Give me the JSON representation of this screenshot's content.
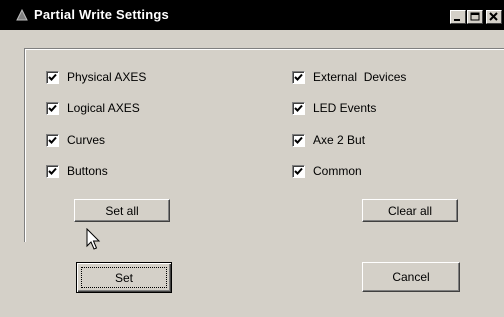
{
  "window": {
    "title": "Partial Write Settings",
    "controls": {
      "minimize": "minimize-icon",
      "maximize": "maximize-icon",
      "close": "close-icon"
    }
  },
  "settings": {
    "left": [
      {
        "label": "Physical AXES",
        "checked": true
      },
      {
        "label": "Logical AXES",
        "checked": true
      },
      {
        "label": "Curves",
        "checked": true
      },
      {
        "label": "Buttons",
        "checked": true
      }
    ],
    "right": [
      {
        "label": "External  Devices",
        "checked": true
      },
      {
        "label": "LED Events",
        "checked": true
      },
      {
        "label": "Axe 2 But",
        "checked": true
      },
      {
        "label": "Common",
        "checked": true
      }
    ],
    "set_all_label": "Set all",
    "clear_all_label": "Clear all"
  },
  "footer": {
    "set_label": "Set",
    "cancel_label": "Cancel"
  },
  "colors": {
    "face": "#d4d0c8",
    "titlebar": "#000000",
    "title_text": "#ffffff"
  }
}
